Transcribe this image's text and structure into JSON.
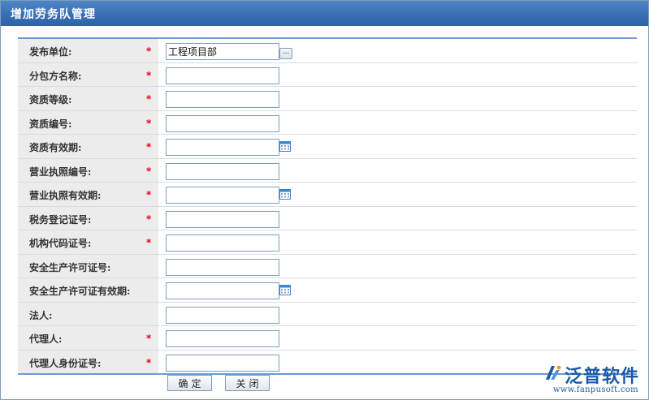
{
  "window": {
    "title": "增加劳务队管理"
  },
  "form": {
    "fields": [
      {
        "label": "发布单位:",
        "required": true,
        "value": "工程项目部",
        "control": "picker"
      },
      {
        "label": "分包方名称:",
        "required": true,
        "value": "",
        "control": "text"
      },
      {
        "label": "资质等级:",
        "required": true,
        "value": "",
        "control": "text"
      },
      {
        "label": "资质编号:",
        "required": true,
        "value": "",
        "control": "text"
      },
      {
        "label": "资质有效期:",
        "required": true,
        "value": "",
        "control": "date"
      },
      {
        "label": "营业执照编号:",
        "required": true,
        "value": "",
        "control": "text"
      },
      {
        "label": "营业执照有效期:",
        "required": true,
        "value": "",
        "control": "date"
      },
      {
        "label": "税务登记证号:",
        "required": true,
        "value": "",
        "control": "text"
      },
      {
        "label": "机构代码证号:",
        "required": true,
        "value": "",
        "control": "text"
      },
      {
        "label": "安全生产许可证号:",
        "required": false,
        "value": "",
        "control": "text"
      },
      {
        "label": "安全生产许可证有效期:",
        "required": false,
        "value": "",
        "control": "date"
      },
      {
        "label": "法人:",
        "required": false,
        "value": "",
        "control": "text"
      },
      {
        "label": "代理人:",
        "required": true,
        "value": "",
        "control": "text"
      },
      {
        "label": "代理人身份证号:",
        "required": true,
        "value": "",
        "control": "text"
      }
    ],
    "required_mark": "*",
    "picker_button_text": "..."
  },
  "buttons": {
    "confirm_label": "确定",
    "close_label": "关闭"
  },
  "branding": {
    "brand_name": "泛普软件",
    "url": "www.fanpusoft.com"
  },
  "colors": {
    "titlebar": "#3a70b6",
    "required": "#e60012",
    "label_bg": "#ececec",
    "brand": "#1b5aa8"
  }
}
